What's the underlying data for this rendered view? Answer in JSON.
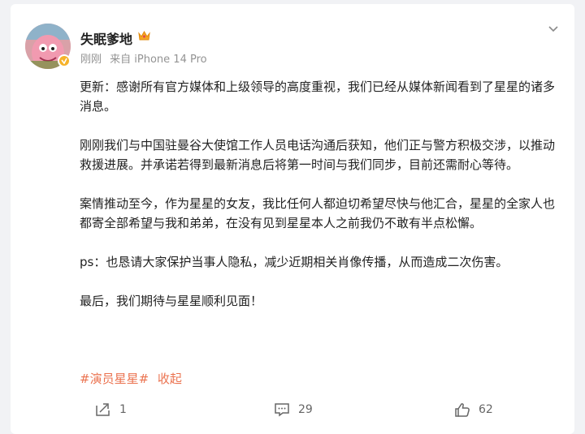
{
  "post": {
    "username": "失眠爹地",
    "time": "刚刚",
    "source": "来自 iPhone 14 Pro",
    "paragraphs": [
      "更新：感谢所有官方媒体和上级领导的高度重视，我们已经从媒体新闻看到了星星的诸多消息。",
      "刚刚我们与中国驻曼谷大使馆工作人员电话沟通后获知，他们正与警方积极交涉，以推动救援进展。并承诺若得到最新消息后将第一时间与我们同步，目前还需耐心等待。",
      "案情推动至今，作为星星的女友，我比任何人都迫切希望尽快与他汇合，星星的全家人也都寄全部希望与我和弟弟，在没有见到星星本人之前我仍不敢有半点松懈。",
      "ps：也恳请大家保护当事人隐私，减少近期相关肖像传播，从而造成二次伤害。",
      "最后，我们期待与星星顺利见面！"
    ],
    "hashtag": "#演员星星#",
    "collapse_label": "收起"
  },
  "actions": {
    "repost_count": "1",
    "comment_count": "29",
    "like_count": "62"
  },
  "icons": {
    "avatar": "avatar-image",
    "verified": "verified-badge-icon",
    "member": "crown-icon",
    "menu": "chevron-down-icon",
    "repost": "share-icon",
    "comment": "comment-icon",
    "like": "thumbs-up-icon"
  },
  "colors": {
    "link": "#eb7350",
    "badge": "#f6b22a",
    "meta_text": "#939393"
  }
}
